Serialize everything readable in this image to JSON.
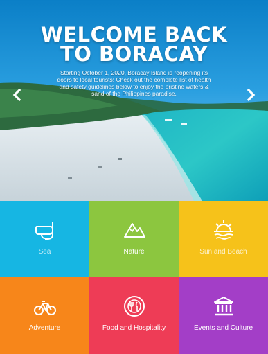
{
  "hero": {
    "title_line1": "WELCOME BACK",
    "title_line2": "TO BORACAY",
    "subtitle": "Starting October 1, 2020, Boracay Island is reopening its doors to local tourists! Check out the complete list of health and safety guidelines below to enjoy the pristine waters & sand of the Philippines paradise.",
    "prev_icon": "chevron-left-icon",
    "next_icon": "chevron-right-icon"
  },
  "categories": [
    {
      "label": "Sea",
      "icon": "snorkel-icon",
      "color": "#16b6e3"
    },
    {
      "label": "Nature",
      "icon": "mountain-icon",
      "color": "#8cc63f"
    },
    {
      "label": "Sun and Beach",
      "icon": "sun-icon",
      "color": "#f6c21a"
    },
    {
      "label": "Adventure",
      "icon": "bicycle-icon",
      "color": "#f7861a"
    },
    {
      "label": "Food and Hospitality",
      "icon": "plate-cutlery-icon",
      "color": "#ee3c56"
    },
    {
      "label": "Events and Culture",
      "icon": "museum-icon",
      "color": "#a33ec7"
    }
  ]
}
